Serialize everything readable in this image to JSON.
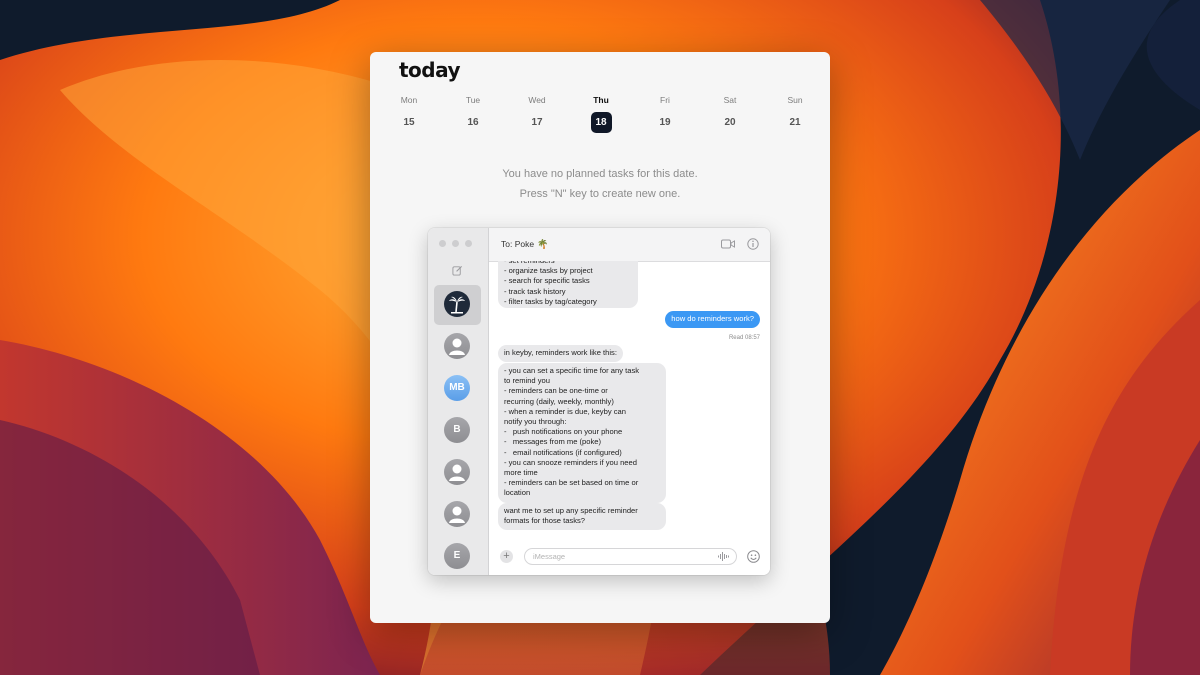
{
  "today_app": {
    "title": "today",
    "week": [
      {
        "day": "Mon",
        "date": "15",
        "selected": false
      },
      {
        "day": "Tue",
        "date": "16",
        "selected": false
      },
      {
        "day": "Wed",
        "date": "17",
        "selected": false
      },
      {
        "day": "Thu",
        "date": "18",
        "selected": true
      },
      {
        "day": "Fri",
        "date": "19",
        "selected": false
      },
      {
        "day": "Sat",
        "date": "20",
        "selected": false
      },
      {
        "day": "Sun",
        "date": "21",
        "selected": false
      }
    ],
    "empty_state": {
      "line1": "You have no planned tasks for this date.",
      "line2": "Press \"N\" key to create new one."
    }
  },
  "messages": {
    "to_label": "To:",
    "recipient": "Poke",
    "recipient_emoji": "🌴",
    "sidebar_avatars": [
      {
        "type": "palm",
        "initials": "",
        "active": true
      },
      {
        "type": "person",
        "initials": "",
        "active": false
      },
      {
        "type": "initials",
        "initials": "MB",
        "active": false
      },
      {
        "type": "initials",
        "initials": "B",
        "active": false
      },
      {
        "type": "person",
        "initials": "",
        "active": false
      },
      {
        "type": "person",
        "initials": "",
        "active": false
      },
      {
        "type": "initials",
        "initials": "E",
        "active": false
      }
    ],
    "thread": [
      {
        "from": "poke",
        "text": "- set reminders\n- organize tasks by project\n- search for specific tasks\n- track task history\n- filter tasks by tag/category"
      },
      {
        "from": "me",
        "text": "how do reminders work?"
      },
      {
        "from": "poke",
        "text": "in keyby, reminders work like this:"
      },
      {
        "from": "poke",
        "text": "- you can set a specific time for any task\nto remind you\n- reminders can be one-time or\nrecurring (daily, weekly, monthly)\n- when a reminder is due, keyby can\nnotify you through:\n-   push notifications on your phone\n-   messages from me (poke)\n-   email notifications (if configured)\n- you can snooze reminders if you need\nmore time\n- reminders can be set based on time or\nlocation"
      },
      {
        "from": "poke",
        "text": "want me to set up any specific reminder\nformats for those tasks?"
      }
    ],
    "read_receipt": "Read 08:57",
    "input_placeholder": "iMessage",
    "input_value": ""
  },
  "colors": {
    "selected_date_bg": "#101828",
    "outgoing_bubble": "#3b98f4",
    "incoming_bubble": "#e9e9eb",
    "wallpaper_orange": "#ff7a10",
    "wallpaper_navy": "#0f1b2c"
  },
  "icons": [
    "compose-icon",
    "video-icon",
    "info-icon",
    "add-icon",
    "waveform-icon",
    "emoji-icon",
    "palm-tree-icon",
    "person-icon"
  ]
}
